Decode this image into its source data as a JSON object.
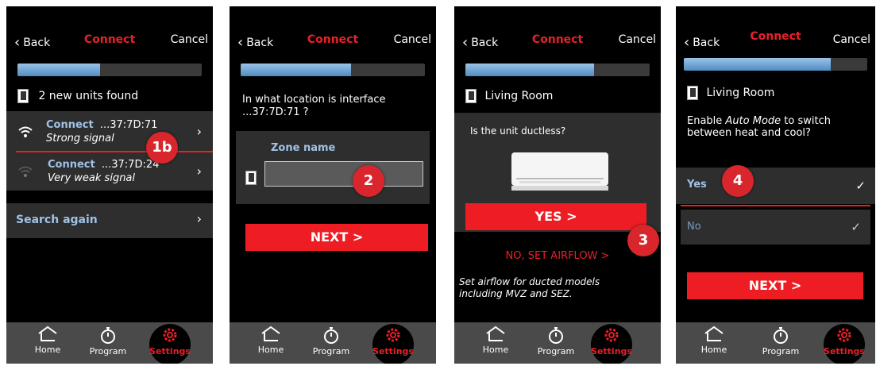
{
  "colors": {
    "accent_red": "#e8202a",
    "button_red": "#ee1d23",
    "progress_blue": "#4f8cc4",
    "link_blue": "#9fc2e6"
  },
  "nav": {
    "back_label": "Back",
    "title": "Connect",
    "cancel_label": "Cancel"
  },
  "tabbar": {
    "home_label": "Home",
    "program_label": "Program",
    "settings_label": "Settings"
  },
  "screen1": {
    "progress": 0.45,
    "found_text": "2 new units found",
    "units": [
      {
        "name": "Connect",
        "id": "...37:7D:71",
        "signal": "Strong signal"
      },
      {
        "name": "Connect",
        "id": "...37:7D:24",
        "signal": "Very weak signal"
      }
    ],
    "search_again": "Search again",
    "badge": "1b"
  },
  "screen2": {
    "progress": 0.6,
    "question": "In what location is interface ...37:7D:71 ?",
    "zone_label": "Zone name",
    "zone_value": "",
    "next_label": "NEXT  >",
    "badge": "2"
  },
  "screen3": {
    "progress": 0.7,
    "room": "Living Room",
    "question": "Is the unit ductless?",
    "yes_label": "YES  >",
    "no_label": "NO, SET AIRFLOW >",
    "airflow_note": "Set airflow for ducted models including MVZ and SEZ.",
    "badge": "3"
  },
  "screen4": {
    "progress": 0.8,
    "room": "Living Room",
    "question_pre": "Enable ",
    "question_em": "Auto Mode",
    "question_post": " to switch between heat and cool?",
    "options": [
      "Yes",
      "No"
    ],
    "next_label": "NEXT  >",
    "badge": "4"
  }
}
